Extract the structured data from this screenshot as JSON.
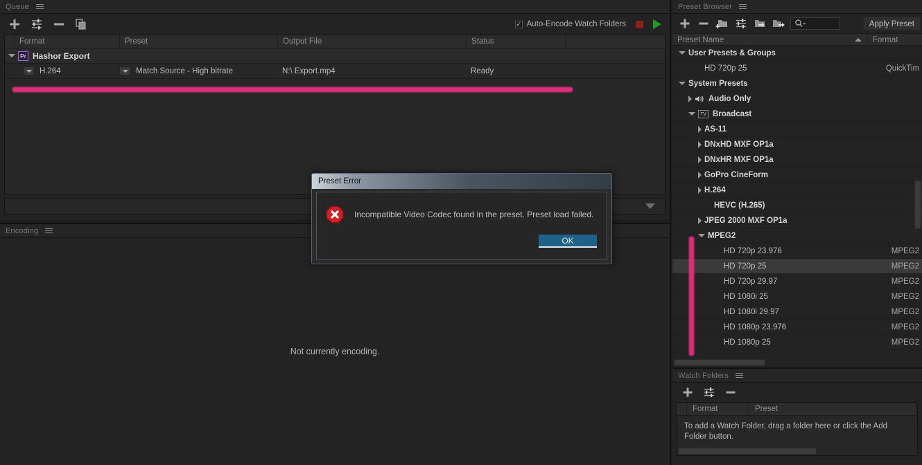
{
  "queue": {
    "panel_title": "Queue",
    "toolbar_icons": [
      "add-icon",
      "preset-settings-icon",
      "remove-icon",
      "duplicate-icon"
    ],
    "auto_encode_label": "Auto-Encode Watch Folders",
    "auto_encode_checked": true,
    "check_glyph": "✓",
    "stop_button": "stop-button",
    "start_button": "start-queue-button",
    "columns": [
      "Format",
      "Preset",
      "Output File",
      "Status"
    ],
    "group_row": {
      "badge": "Pr",
      "label": "Hashor Export"
    },
    "item_row": {
      "format": "H.264",
      "preset": "Match Source - High bitrate",
      "output_file": "N:\\  Export.mp4",
      "status": "Ready"
    }
  },
  "encoding": {
    "panel_title": "Encoding",
    "message": "Not currently encoding."
  },
  "preset_browser": {
    "panel_title": "Preset Browser",
    "toolbar_icons": [
      "new-preset-icon",
      "delete-preset-icon",
      "new-folder-icon",
      "preset-settings-icon",
      "import-preset-icon",
      "export-preset-icon",
      "search-icon"
    ],
    "search_placeholder": "",
    "apply_preset_label": "Apply Preset",
    "columns": [
      "Preset Name",
      "Format"
    ],
    "sort_indicator": "ascending",
    "rows": [
      {
        "label": "User Presets & Groups",
        "format": "",
        "indent": 0,
        "twisty": "down",
        "bold": true,
        "icon": "",
        "selected": false
      },
      {
        "label": "HD 720p 25",
        "format": "QuickTim",
        "indent": 2,
        "twisty": "",
        "bold": false,
        "icon": "",
        "selected": false
      },
      {
        "label": "System Presets",
        "format": "",
        "indent": 0,
        "twisty": "down",
        "bold": true,
        "icon": "",
        "selected": false
      },
      {
        "label": "Audio Only",
        "format": "",
        "indent": 1,
        "twisty": "right",
        "bold": true,
        "icon": "speaker-icon",
        "selected": false
      },
      {
        "label": "Broadcast",
        "format": "",
        "indent": 1,
        "twisty": "down",
        "bold": true,
        "icon": "tv-icon",
        "selected": false
      },
      {
        "label": "AS-11",
        "format": "",
        "indent": 2,
        "twisty": "right",
        "bold": true,
        "icon": "",
        "selected": false
      },
      {
        "label": "DNxHD MXF OP1a",
        "format": "",
        "indent": 2,
        "twisty": "right",
        "bold": true,
        "icon": "",
        "selected": false
      },
      {
        "label": "DNxHR MXF OP1a",
        "format": "",
        "indent": 2,
        "twisty": "right",
        "bold": true,
        "icon": "",
        "selected": false
      },
      {
        "label": "GoPro CineForm",
        "format": "",
        "indent": 2,
        "twisty": "right",
        "bold": true,
        "icon": "",
        "selected": false
      },
      {
        "label": "H.264",
        "format": "",
        "indent": 2,
        "twisty": "right",
        "bold": true,
        "icon": "",
        "selected": false
      },
      {
        "label": "HEVC (H.265)",
        "format": "",
        "indent": 3,
        "twisty": "",
        "bold": true,
        "icon": "",
        "selected": false
      },
      {
        "label": "JPEG 2000 MXF OP1a",
        "format": "",
        "indent": 2,
        "twisty": "right",
        "bold": true,
        "icon": "",
        "selected": false
      },
      {
        "label": "MPEG2",
        "format": "",
        "indent": 2,
        "twisty": "down",
        "bold": true,
        "icon": "",
        "selected": false
      },
      {
        "label": "HD 720p 23.976",
        "format": "MPEG2",
        "indent": 4,
        "twisty": "",
        "bold": false,
        "icon": "",
        "selected": false
      },
      {
        "label": "HD 720p 25",
        "format": "MPEG2",
        "indent": 4,
        "twisty": "",
        "bold": false,
        "icon": "",
        "selected": true
      },
      {
        "label": "HD 720p 29.97",
        "format": "MPEG2",
        "indent": 4,
        "twisty": "",
        "bold": false,
        "icon": "",
        "selected": false
      },
      {
        "label": "HD 1080i 25",
        "format": "MPEG2",
        "indent": 4,
        "twisty": "",
        "bold": false,
        "icon": "",
        "selected": false
      },
      {
        "label": "HD 1080i 29.97",
        "format": "MPEG2",
        "indent": 4,
        "twisty": "",
        "bold": false,
        "icon": "",
        "selected": false
      },
      {
        "label": "HD 1080p 23.976",
        "format": "MPEG2",
        "indent": 4,
        "twisty": "",
        "bold": false,
        "icon": "",
        "selected": false
      },
      {
        "label": "HD 1080p 25",
        "format": "MPEG2",
        "indent": 4,
        "twisty": "",
        "bold": false,
        "icon": "",
        "selected": false
      }
    ]
  },
  "watch_folders": {
    "panel_title": "Watch Folders",
    "toolbar_icons": [
      "add-folder-icon",
      "settings-icon",
      "remove-folder-icon"
    ],
    "columns": [
      "Format",
      "Preset"
    ],
    "empty_message": "To add a Watch Folder, drag a folder here or click the Add Folder button."
  },
  "dialog": {
    "title": "Preset Error",
    "message": "Incompatible Video Codec found in the preset. Preset load failed.",
    "ok_label": "OK",
    "icon": "error-octagon-icon"
  },
  "annotations": {
    "marker_color": "#e8307f",
    "queue_marker": "queue-row-highlight",
    "preset_marker": "preset-group-highlight"
  }
}
